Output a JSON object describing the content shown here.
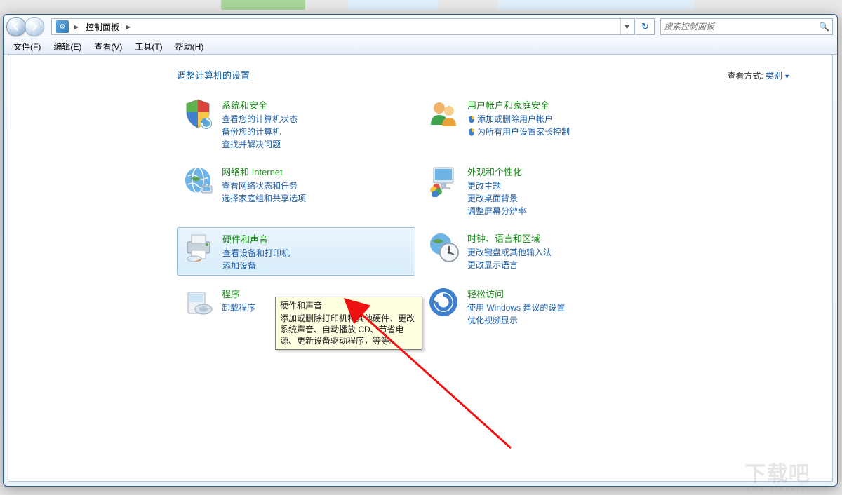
{
  "window": {
    "breadcrumb_icon_label": "控制面板",
    "breadcrumb": "控制面板",
    "search_placeholder": "搜索控制面板"
  },
  "menu": {
    "file": "文件(F)",
    "edit": "编辑(E)",
    "view": "查看(V)",
    "tools": "工具(T)",
    "help": "帮助(H)"
  },
  "page": {
    "title": "调整计算机的设置",
    "viewby_label": "查看方式:",
    "viewby_value": "类别"
  },
  "cats": {
    "system": {
      "title": "系统和安全",
      "l1": "查看您的计算机状态",
      "l2": "备份您的计算机",
      "l3": "查找并解决问题"
    },
    "network": {
      "title": "网络和 Internet",
      "l1": "查看网络状态和任务",
      "l2": "选择家庭组和共享选项"
    },
    "hardware": {
      "title": "硬件和声音",
      "l1": "查看设备和打印机",
      "l2": "添加设备"
    },
    "programs": {
      "title": "程序",
      "l1": "卸载程序"
    },
    "users": {
      "title": "用户帐户和家庭安全",
      "l1": "添加或删除用户帐户",
      "l2": "为所有用户设置家长控制"
    },
    "appearance": {
      "title": "外观和个性化",
      "l1": "更改主题",
      "l2": "更改桌面背景",
      "l3": "调整屏幕分辨率"
    },
    "clock": {
      "title": "时钟、语言和区域",
      "l1": "更改键盘或其他输入法",
      "l2": "更改显示语言"
    },
    "ease": {
      "title": "轻松访问",
      "l1": "使用 Windows 建议的设置",
      "l2": "优化视频显示"
    }
  },
  "tooltip": {
    "title": "硬件和声音",
    "body": "添加或删除打印机和其他硬件、更改系统声音、自动播放 CD、节省电源、更新设备驱动程序，等等。"
  },
  "watermark": {
    "main": "下载吧",
    "sub": "www.xiazaiba.com"
  }
}
